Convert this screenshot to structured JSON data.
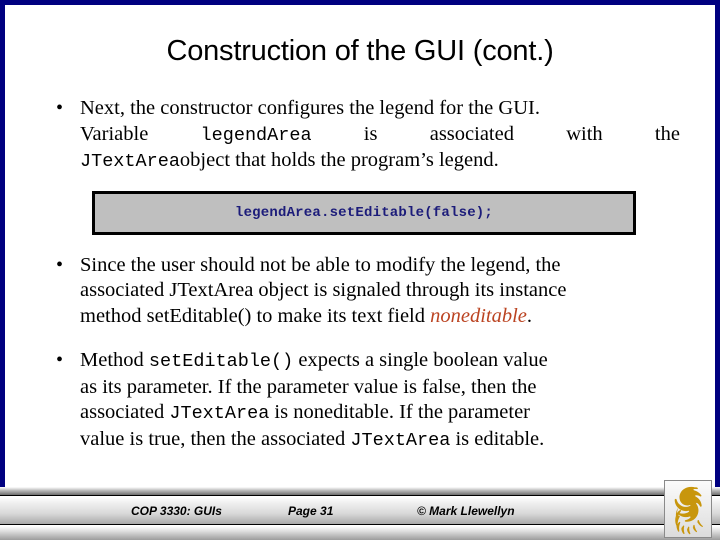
{
  "slide": {
    "title": "Construction of the GUI (cont.)",
    "frame_color": "#000080",
    "background": "#ffffff"
  },
  "bullets": [
    {
      "id": "bullet-1",
      "marker": "•",
      "segments": [
        {
          "text": "Next, the constructor configures the legend for the GUI. Variable ",
          "style": "serif"
        },
        {
          "text": "legendArea",
          "style": "mono"
        },
        {
          "text": " is associated with the ",
          "style": "serif"
        },
        {
          "text": "JTextArea",
          "style": "mono"
        },
        {
          "text": " object that holds the program’s legend.",
          "style": "serif"
        }
      ],
      "line1": "Next, the constructor configures the legend for the GUI.",
      "line2_a": "Variable",
      "line2_mono": "legendArea",
      "line2_b": "is",
      "line2_c": "associated",
      "line2_d": "with",
      "line2_e": "the",
      "line3_mono": "JTextArea",
      "line3_b": "object that holds the program’s legend."
    },
    {
      "id": "bullet-2",
      "marker": "•",
      "line1": "Since the user should not be able to modify the legend, the",
      "line2": "associated JTextArea object is signaled through its instance",
      "line3_a": "method setEditable() to make its text field ",
      "line3_emph": "noneditable",
      "line3_b": ".",
      "emph_color": "#bb4422"
    },
    {
      "id": "bullet-3",
      "marker": "•",
      "line1_a": "Method ",
      "line1_mono": "setEditable()",
      "line1_b": " expects a single boolean value",
      "line2": "as its parameter.  If the parameter value is false, then the",
      "line3_a": "associated ",
      "line3_mono": "JTextArea",
      "line3_b": " is noneditable.  If the parameter",
      "line4_a": "value is true, then the associated ",
      "line4_mono": "JTextArea",
      "line4_b": " is editable."
    }
  ],
  "code_box": {
    "text": "legendArea.setEditable(false);",
    "fill_color": "#bfbfbf",
    "border_color": "#000000",
    "text_color": "#1c1c7a"
  },
  "footer": {
    "course": "COP 3330:  GUIs",
    "page": "Page 31",
    "credit": "© Mark Llewellyn",
    "logo_name": "ucf-pegasus-logo",
    "logo_color": "#c8960c"
  }
}
